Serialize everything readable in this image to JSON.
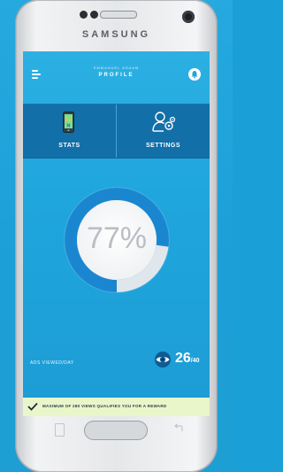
{
  "device": {
    "brand": "SAMSUNG"
  },
  "app": {
    "user_name": "EMMANUEL ASAAM",
    "title": "PROFILE"
  },
  "nav": {
    "items": [
      {
        "label": "STATS",
        "icon": "phone-icon"
      },
      {
        "label": "SETTINGS",
        "icon": "user-settings-icon"
      }
    ]
  },
  "progress": {
    "percent_text": "77%",
    "value": 0.77
  },
  "ads": {
    "label": "ADS VIEWED/DAY",
    "count": "26",
    "total": "/40"
  },
  "banner": {
    "text": "MAXIMUM OF 280 VIEWS QUALIFIES YOU FOR A REWARD"
  },
  "colors": {
    "screen_bg": "#1fa6dd",
    "nav_bg": "#136fa8",
    "ring": "#1b86d0",
    "banner_bg": "#e9f6c9"
  }
}
